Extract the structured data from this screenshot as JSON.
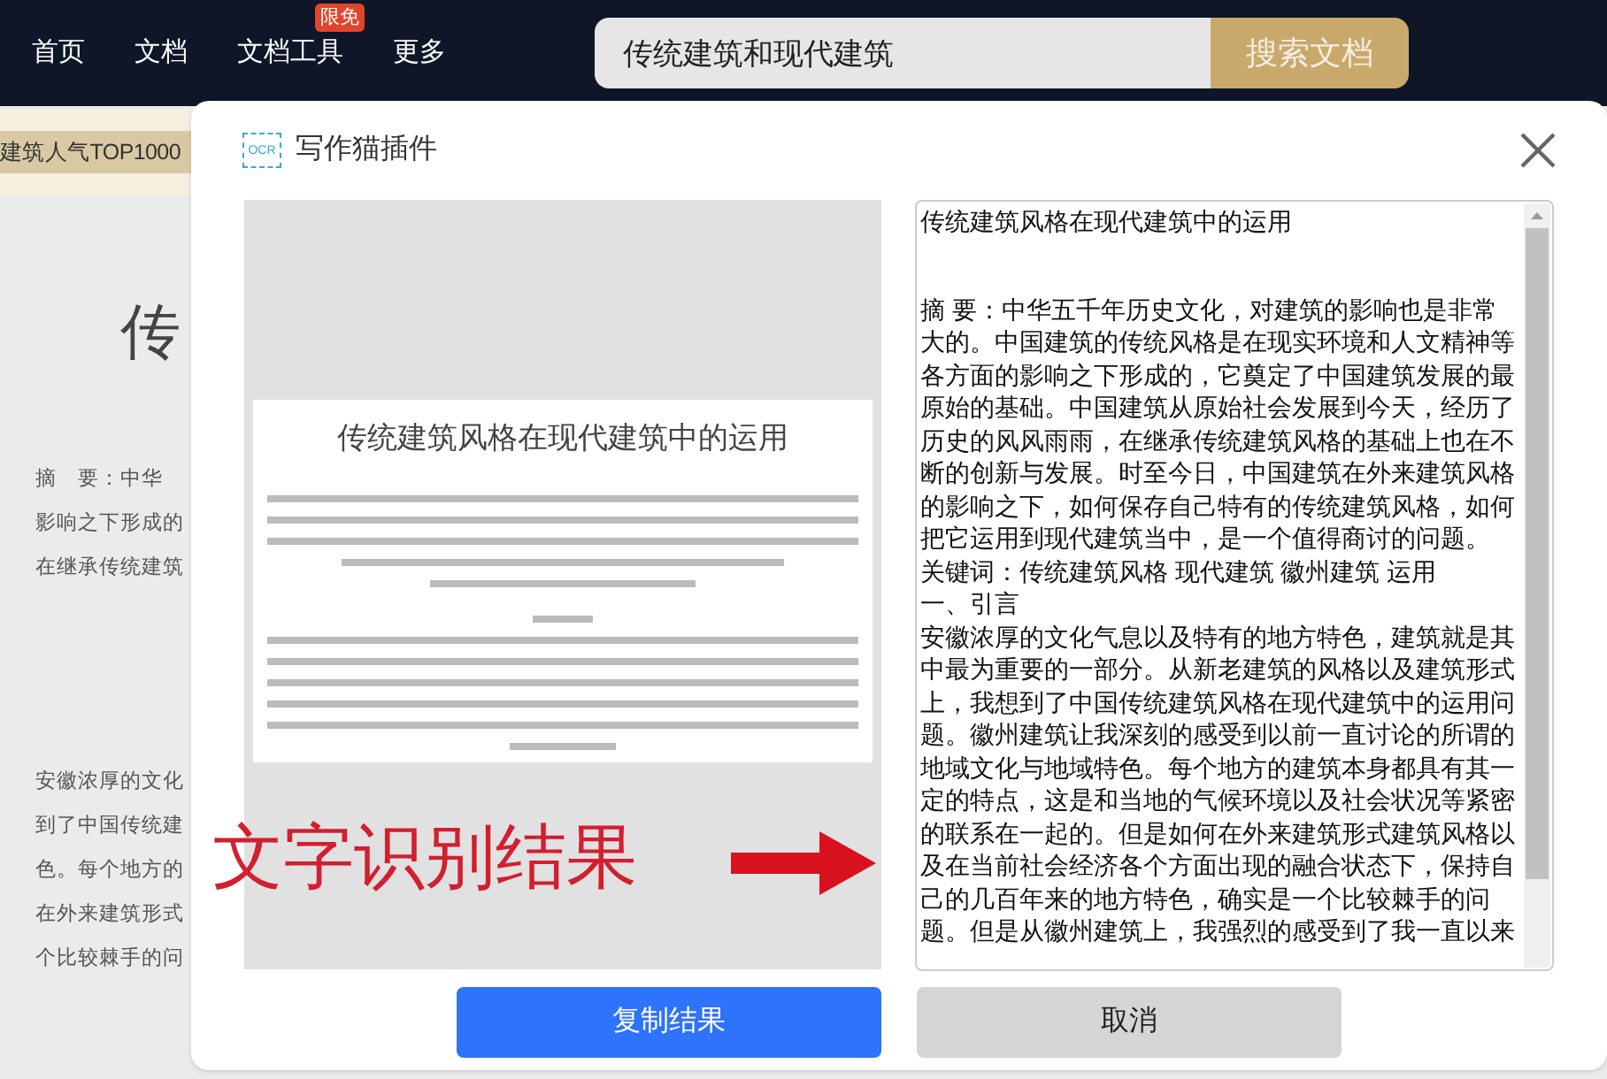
{
  "nav": {
    "items": [
      {
        "label": "首页"
      },
      {
        "label": "文档"
      },
      {
        "label": "文档工具",
        "badge": "限免"
      },
      {
        "label": "更多"
      }
    ],
    "search": {
      "value": "传统建筑和现代建筑",
      "button": "搜索文档"
    }
  },
  "background_page": {
    "tag": "建筑人气TOP1000",
    "heading": "传",
    "lines_top": [
      "摘　要：中华",
      "影响之下形成的",
      "在继承传统建筑"
    ],
    "lines_bottom": [
      "安徽浓厚的文化",
      "到了中国传统建",
      "色。每个地方的",
      "在外来建筑形式",
      "个比较棘手的问"
    ]
  },
  "dialog": {
    "icon_label": "OCR",
    "title": "写作猫插件",
    "preview": {
      "title": "传统建筑风格在现代建筑中的运用"
    },
    "annotation": {
      "text": "文字识别结果"
    },
    "result": {
      "title": "传统建筑风格在现代建筑中的运用",
      "lines": [
        "摘 要：中华五千年历史文化，对建筑的影响也是非常",
        "大的。中国建筑的传统风格是在现实环境和人文精神等",
        "各方面的影响之下形成的，它奠定了中国建筑发展的最",
        "原始的基础。中国建筑从原始社会发展到今天，经历了",
        "历史的风风雨雨，在继承传统建筑风格的基础上也在不",
        "断的创新与发展。时至今日，中国建筑在外来建筑风格",
        "的影响之下，如何保存自己特有的传统建筑风格，如何",
        "把它运用到现代建筑当中，是一个值得商讨的问题。",
        "关键词：传统建筑风格 现代建筑 徽州建筑 运用",
        "一、引言",
        "安徽浓厚的文化气息以及特有的地方特色，建筑就是其",
        "中最为重要的一部分。从新老建筑的风格以及建筑形式",
        "上，我想到了中国传统建筑风格在现代建筑中的运用问",
        "题。徽州建筑让我深刻的感受到以前一直讨论的所谓的",
        "地域文化与地域特色。每个地方的建筑本身都具有其一",
        "定的特点，这是和当地的气候环境以及社会状况等紧密",
        "的联系在一起的。但是如何在外来建筑形式建筑风格以",
        "及在当前社会经济各个方面出现的融合状态下，保持自",
        "己的几百年来的地方特色，确实是一个比较棘手的问",
        "题。但是从徽州建筑上，我强烈的感受到了我一直以来"
      ]
    },
    "buttons": [
      {
        "label": "复制结果",
        "kind": "primary"
      },
      {
        "label": "取消",
        "kind": "secondary"
      }
    ]
  }
}
